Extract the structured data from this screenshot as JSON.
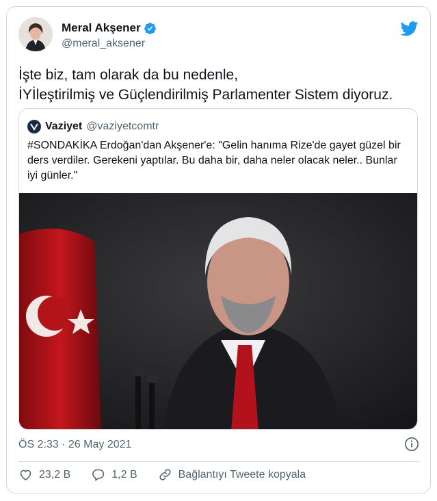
{
  "tweet": {
    "author_name": "Meral Akşener",
    "author_handle": "@meral_aksener",
    "text_line1": "İşte biz, tam olarak da bu nedenle,",
    "text_line2": "İYİleştirilmiş ve Güçlendirilmiş Parlamenter Sistem diyoruz.",
    "timestamp": "ÖS 2:33 · 26 May 2021"
  },
  "quoted": {
    "author_name": "Vaziyet",
    "author_handle": "@vaziyetcomtr",
    "text": "#SONDAKİKA Erdoğan'dan Akşener'e: \"Gelin hanıma Rize'de gayet güzel bir ders verdiler. Gerekeni yaptılar. Bu daha bir, daha neler olacak neler.. Bunlar iyi günler.\""
  },
  "actions": {
    "likes": "23,2 B",
    "replies": "1,2 B",
    "copy_link": "Bağlantıyı Tweete kopyala"
  },
  "icons": {
    "verified": "verified-badge-icon",
    "brand": "twitter-bird-icon",
    "info": "info-icon",
    "like": "heart-icon",
    "reply": "reply-icon",
    "link": "link-icon"
  },
  "colors": {
    "twitter_blue": "#1d9bf0",
    "text_primary": "#0f1419",
    "text_secondary": "#536471",
    "border": "#cfd9de"
  }
}
